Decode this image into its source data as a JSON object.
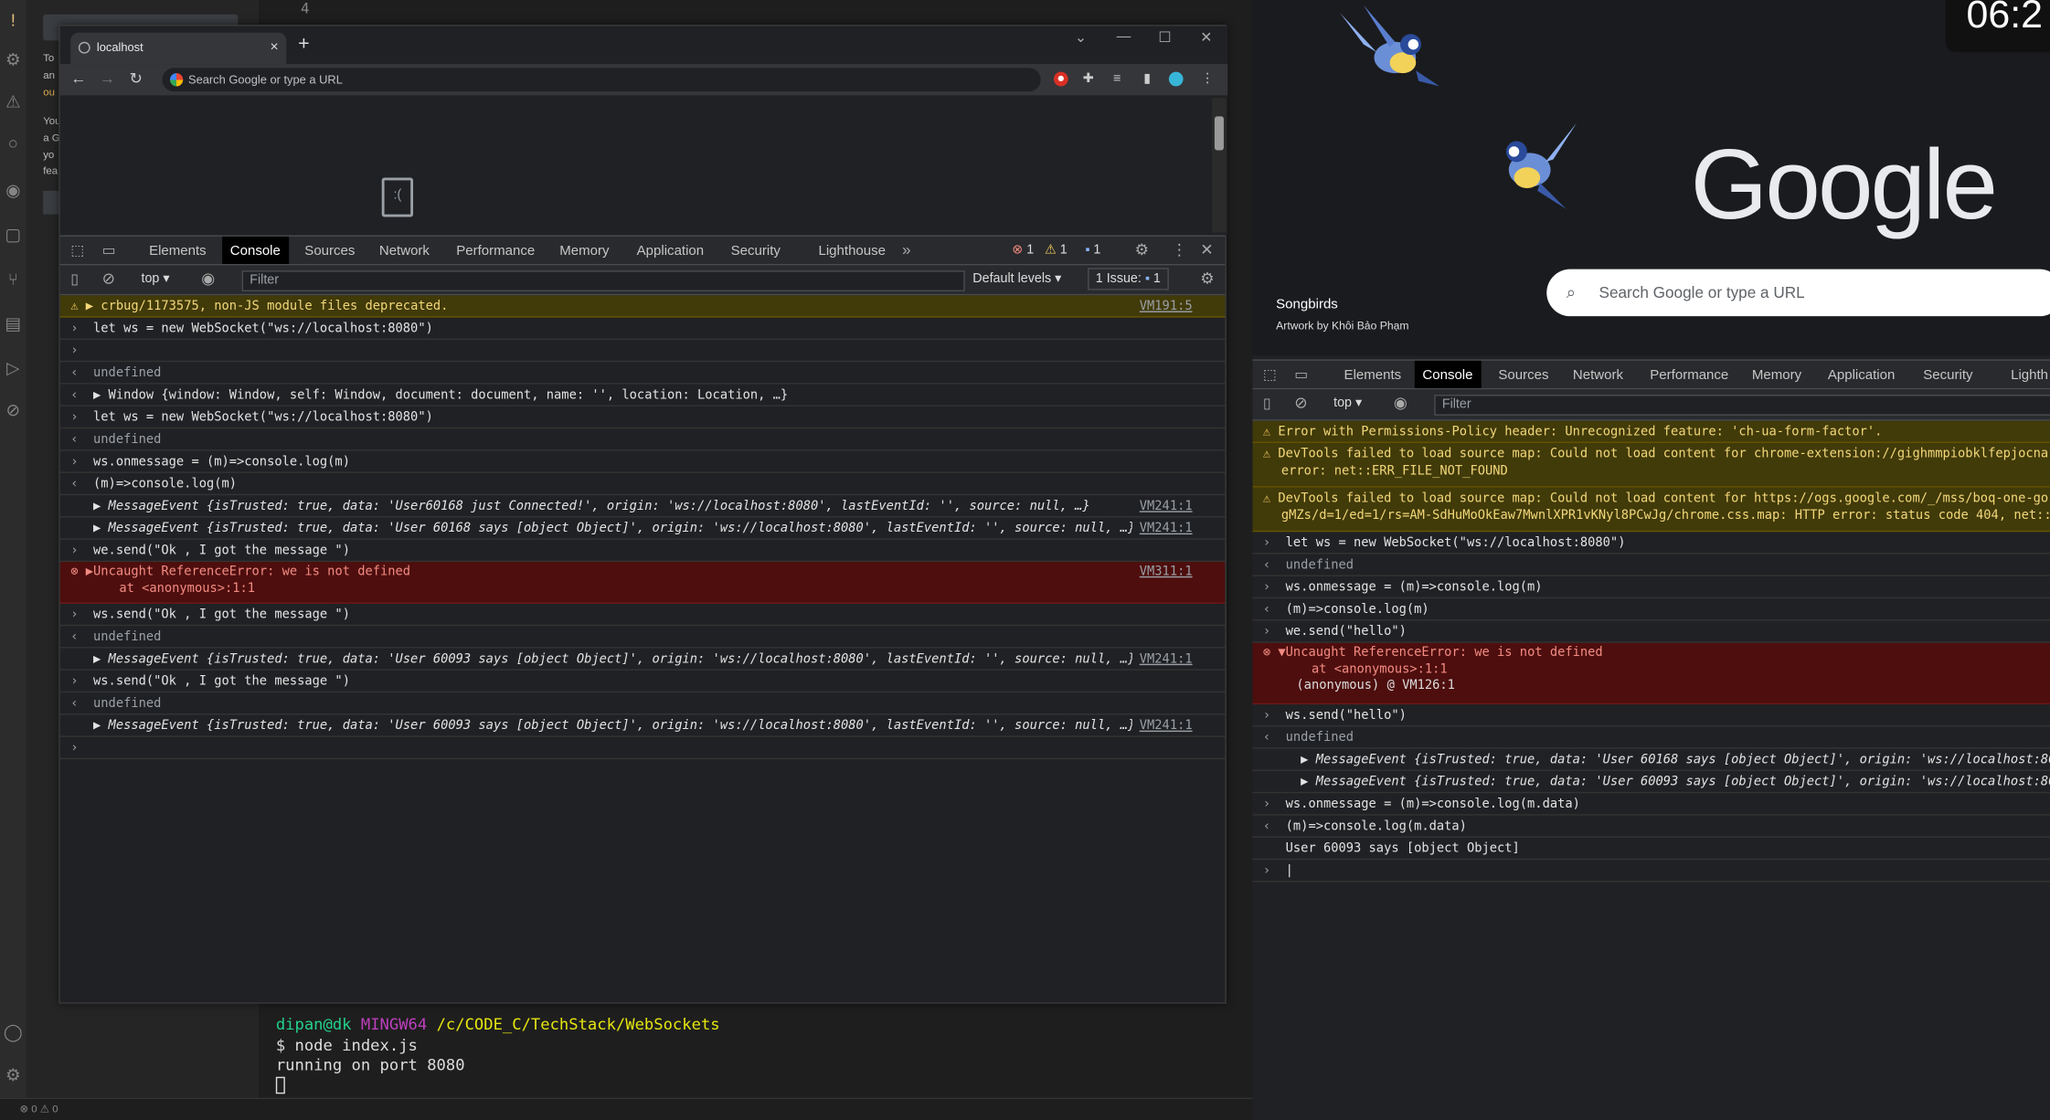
{
  "vscode": {
    "line_number": "4",
    "side_text": [
      "To",
      "an",
      "ou",
      "You",
      "a G",
      "yo",
      "fea"
    ],
    "terminal": {
      "prompt_user": "dipan@dk",
      "prompt_host": "MINGW64",
      "prompt_path": "/c/CODE_C/TechStack/WebSockets",
      "command": "$ node index.js",
      "output": "running on port 8080"
    },
    "status": "⊗ 0 ⚠ 0"
  },
  "chrome1": {
    "tab_title": "localhost",
    "tab_close": "×",
    "new_tab": "+",
    "omnibox_placeholder": "Search Google or type a URL",
    "window_controls": [
      "⌄",
      "—",
      "☐",
      "✕"
    ]
  },
  "devtools1": {
    "tabs": [
      "Elements",
      "Console",
      "Sources",
      "Network",
      "Performance",
      "Memory",
      "Application",
      "Security",
      "Lighthouse"
    ],
    "active_tab": "Console",
    "errors_count": "1",
    "warnings_count": "1",
    "info_count": "1",
    "context": "top",
    "filter_placeholder": "Filter",
    "levels": "Default levels",
    "issues": "1 Issue:",
    "issues_count": "1",
    "log": [
      {
        "type": "warn",
        "text": "▶ crbug/1173575, non-JS module files deprecated.",
        "src": "VM191:5"
      },
      {
        "type": "in",
        "text": "let ws = new WebSocket(\"ws://localhost:8080\")"
      },
      {
        "type": "in",
        "text": ""
      },
      {
        "type": "out",
        "text": "undefined"
      },
      {
        "type": "out",
        "text": "▶ Window {window: Window, self: Window, document: document, name: '', location: Location, …}"
      },
      {
        "type": "in",
        "text": "let ws = new WebSocket(\"ws://localhost:8080\")"
      },
      {
        "type": "out",
        "text": "undefined"
      },
      {
        "type": "in",
        "text": "ws.onmessage = (m)=>console.log(m)"
      },
      {
        "type": "out",
        "text": "(m)=>console.log(m)"
      },
      {
        "type": "msg",
        "text": "▶ MessageEvent {isTrusted: true, data: 'User60168 just Connected!', origin: 'ws://localhost:8080', lastEventId: '', source: null, …}",
        "src": "VM241:1"
      },
      {
        "type": "msg",
        "text": "▶ MessageEvent {isTrusted: true, data: 'User 60168 says [object Object]', origin: 'ws://localhost:8080', lastEventId: '', source: null, …}",
        "src": "VM241:1"
      },
      {
        "type": "in",
        "text": "we.send(\"Ok , I got the message \")"
      },
      {
        "type": "err",
        "text": "▶Uncaught ReferenceError: we is not defined",
        "text2": "    at <anonymous>:1:1",
        "src": "VM311:1"
      },
      {
        "type": "in",
        "text": "ws.send(\"Ok , I got the message \")"
      },
      {
        "type": "out",
        "text": "undefined"
      },
      {
        "type": "msg",
        "text": "▶ MessageEvent {isTrusted: true, data: 'User 60093 says [object Object]', origin: 'ws://localhost:8080', lastEventId: '', source: null, …}",
        "src": "VM241:1"
      },
      {
        "type": "in",
        "text": "ws.send(\"Ok , I got the message \")"
      },
      {
        "type": "out",
        "text": "undefined"
      },
      {
        "type": "msg",
        "text": "▶ MessageEvent {isTrusted: true, data: 'User 60093 says [object Object]', origin: 'ws://localhost:8080', lastEventId: '', source: null, …}",
        "src": "VM241:1"
      },
      {
        "type": "in",
        "text": ""
      }
    ]
  },
  "right": {
    "clock": "06:2",
    "google_logo": "Google",
    "doodle_title": "Songbirds",
    "doodle_credit": "Artwork by Khôi Bảo Phạm",
    "search_placeholder": "Search Google or type a URL"
  },
  "devtools2": {
    "tabs": [
      "Elements",
      "Console",
      "Sources",
      "Network",
      "Performance",
      "Memory",
      "Application",
      "Security",
      "Lighth"
    ],
    "active_tab": "Console",
    "context": "top",
    "filter_placeholder": "Filter",
    "log": [
      {
        "type": "warn",
        "text": "Error with Permissions-Policy header: Unrecognized feature: 'ch-ua-form-factor'."
      },
      {
        "type": "warn",
        "text": "DevTools failed to load source map: Could not load content for chrome-extension://gighmmpiobklfepjocna",
        "text2": "error: net::ERR_FILE_NOT_FOUND"
      },
      {
        "type": "warn",
        "text": "DevTools failed to load source map: Could not load content for https://ogs.google.com/_/mss/boq-one-go",
        "text2": "gMZs/d=1/ed=1/rs=AM-SdHuMoOkEaw7MwnlXPR1vKNyl8PCwJg/chrome.css.map: HTTP error: status code 404, net::"
      },
      {
        "type": "in",
        "text": "let ws = new WebSocket(\"ws://localhost:8080\")"
      },
      {
        "type": "out",
        "text": "undefined"
      },
      {
        "type": "in",
        "text": "ws.onmessage = (m)=>console.log(m)"
      },
      {
        "type": "out",
        "text": "(m)=>console.log(m)"
      },
      {
        "type": "in",
        "text": "we.send(\"hello\")"
      },
      {
        "type": "err",
        "text": "▼Uncaught ReferenceError: we is not defined",
        "text2": "    at <anonymous>:1:1",
        "text3": "  (anonymous) @ VM126:1"
      },
      {
        "type": "in",
        "text": "ws.send(\"hello\")"
      },
      {
        "type": "out",
        "text": "undefined"
      },
      {
        "type": "msg",
        "text": "  ▶ MessageEvent {isTrusted: true, data: 'User 60168 says [object Object]', origin: 'ws://localhost:8080"
      },
      {
        "type": "msg",
        "text": "  ▶ MessageEvent {isTrusted: true, data: 'User 60093 says [object Object]', origin: 'ws://localhost:8080"
      },
      {
        "type": "in",
        "text": "ws.onmessage = (m)=>console.log(m.data)"
      },
      {
        "type": "out",
        "text": "(m)=>console.log(m.data)"
      },
      {
        "type": "plain",
        "text": "User 60093 says [object Object]"
      },
      {
        "type": "in",
        "text": "|"
      }
    ]
  }
}
